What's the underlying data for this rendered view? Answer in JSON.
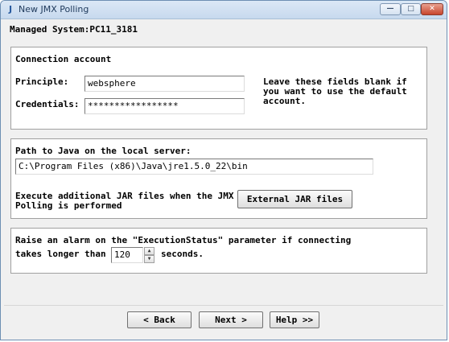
{
  "window": {
    "title": "New JMX Polling",
    "app_icon": "J"
  },
  "managed_system": "Managed System:PC11_3181",
  "connection": {
    "heading": "Connection account",
    "principle_label": "Principle:",
    "principle_value": "websphere",
    "credentials_label": "Credentials:",
    "credentials_value": "*****************",
    "hint_line1": "Leave these fields blank if",
    "hint_line2": "you want to use the default",
    "hint_line3": "account."
  },
  "java": {
    "path_label": "Path to Java on the local server:",
    "path_value": "C:\\Program Files (x86)\\Java\\jre1.5.0_22\\bin",
    "jar_text_line1": "Execute additional JAR files when the JMX",
    "jar_text_line2": "Polling is performed",
    "jar_button": "External JAR files"
  },
  "alarm": {
    "text_line1": "Raise an alarm on the \"ExecutionStatus\" parameter if connecting",
    "text_prefix": "takes longer than",
    "timeout_value": "120",
    "text_suffix": "seconds.",
    "spin_up": "▲",
    "spin_down": "▼"
  },
  "buttons": {
    "back": "< Back",
    "next": "Next >",
    "help": "Help >>"
  },
  "window_buttons": {
    "minimize": "—",
    "maximize": "□",
    "close": "✕"
  }
}
